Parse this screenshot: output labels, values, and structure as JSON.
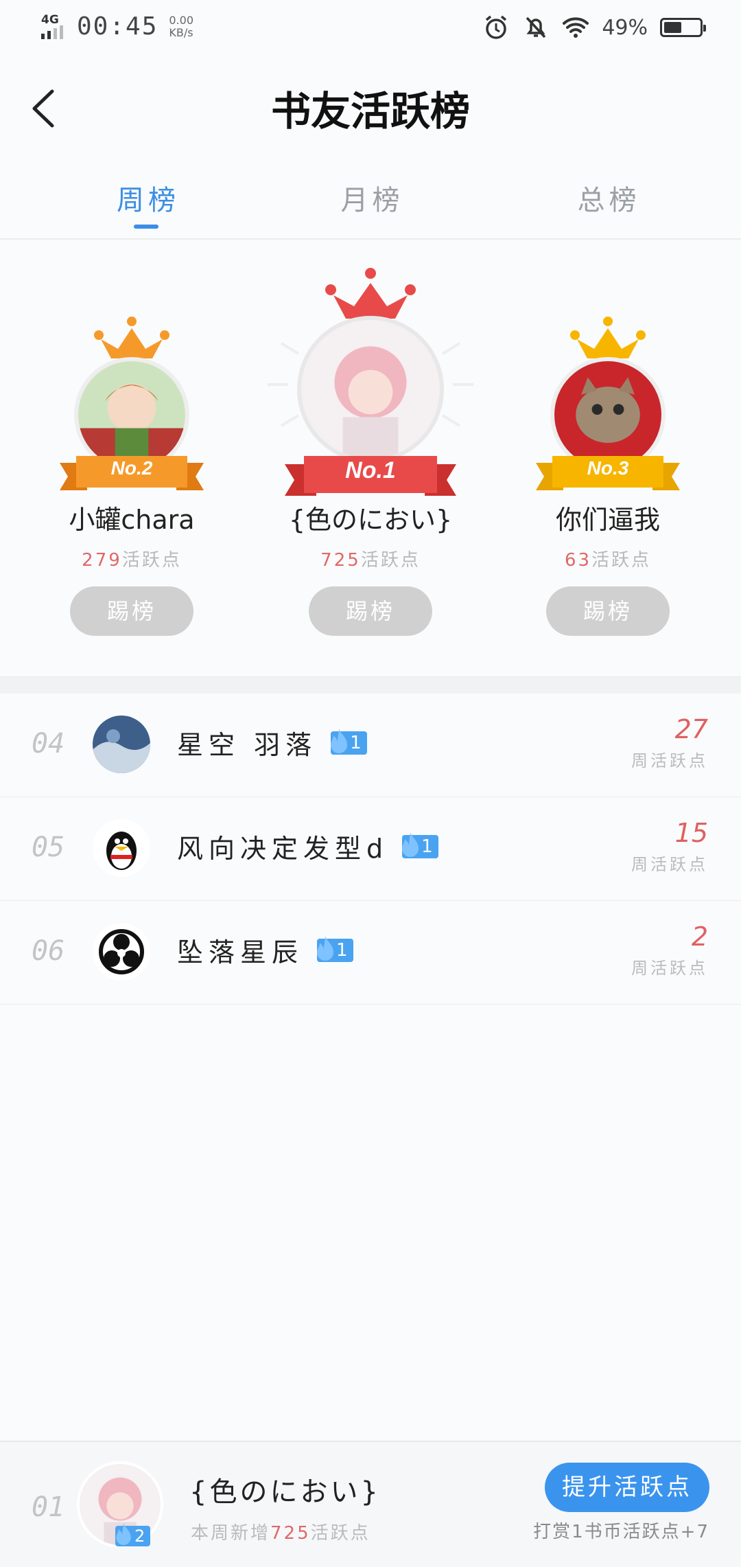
{
  "status": {
    "network": "4G",
    "time": "00:45",
    "speed_value": "0.00",
    "speed_unit": "KB/s",
    "battery": "49%"
  },
  "header": {
    "title": "书友活跃榜"
  },
  "tabs": [
    {
      "label": "周榜",
      "active": true
    },
    {
      "label": "月榜",
      "active": false
    },
    {
      "label": "总榜",
      "active": false
    }
  ],
  "podium": [
    {
      "rank_label": "No.2",
      "name": "小罐chara",
      "points": "279",
      "points_suffix": "活跃点",
      "kick_label": "踢榜"
    },
    {
      "rank_label": "No.1",
      "name": "{色のにおい}",
      "points": "725",
      "points_suffix": "活跃点",
      "kick_label": "踢榜"
    },
    {
      "rank_label": "No.3",
      "name": "你们逼我",
      "points": "63",
      "points_suffix": "活跃点",
      "kick_label": "踢榜"
    }
  ],
  "list": [
    {
      "rank": "04",
      "name": "星空 羽落",
      "level": "1",
      "score": "27",
      "score_label": "周活跃点"
    },
    {
      "rank": "05",
      "name": "风向决定发型d",
      "level": "1",
      "score": "15",
      "score_label": "周活跃点"
    },
    {
      "rank": "06",
      "name": "坠落星辰",
      "level": "1",
      "score": "2",
      "score_label": "周活跃点"
    }
  ],
  "me": {
    "rank": "01",
    "name": "{色のにおい}",
    "level": "2",
    "sub_prefix": "本周新增",
    "sub_value": "725",
    "sub_suffix": "活跃点",
    "boost_label": "提升活跃点",
    "reward_text": "打赏1书币活跃点+7"
  },
  "colors": {
    "accent": "#3b8ee6",
    "red": "#e06060",
    "gold": "#f7b500",
    "orange": "#f59a2a"
  }
}
